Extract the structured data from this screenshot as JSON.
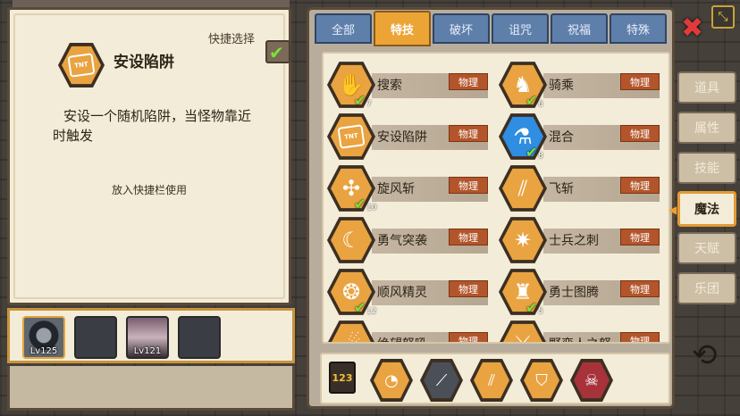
{
  "detail": {
    "quick_select_label": "快捷选择",
    "quick_select_checked": true,
    "icon": "tnt-icon",
    "title": "安设陷阱",
    "description_line1": "安设一个随机陷阱，当怪物靠近",
    "description_line2": "时触发",
    "hint": "放入快捷栏使用"
  },
  "quickbar": {
    "slots": [
      {
        "filled": true,
        "level": "Lv125"
      },
      {
        "filled": false,
        "level": ""
      },
      {
        "filled": true,
        "level": "Lv121"
      },
      {
        "filled": false,
        "level": ""
      }
    ]
  },
  "tabs": [
    "全部",
    "特技",
    "破坏",
    "诅咒",
    "祝福",
    "特殊"
  ],
  "active_tab": "特技",
  "skills": [
    {
      "name": "搜索",
      "type": "物理",
      "icon": "search-hand-icon",
      "checked": true,
      "count": "7"
    },
    {
      "name": "骑乘",
      "type": "物理",
      "icon": "horse-icon",
      "checked": true,
      "count": "6"
    },
    {
      "name": "安设陷阱",
      "type": "物理",
      "icon": "tnt-icon",
      "checked": false,
      "count": ""
    },
    {
      "name": "混合",
      "type": "物理",
      "icon": "flask-icon",
      "checked": true,
      "count": "8"
    },
    {
      "name": "旋风斩",
      "type": "物理",
      "icon": "whirlwind-icon",
      "checked": true,
      "count": "10"
    },
    {
      "name": "飞斩",
      "type": "物理",
      "icon": "flying-slash-icon",
      "checked": false,
      "count": ""
    },
    {
      "name": "勇气突袭",
      "type": "物理",
      "icon": "charge-icon",
      "checked": false,
      "count": ""
    },
    {
      "name": "士兵之刺",
      "type": "物理",
      "icon": "spike-icon",
      "checked": false,
      "count": ""
    },
    {
      "name": "顺风精灵",
      "type": "物理",
      "icon": "wind-spirit-icon",
      "checked": true,
      "count": "12"
    },
    {
      "name": "勇士图腾",
      "type": "物理",
      "icon": "totem-icon",
      "checked": true,
      "count": "5"
    },
    {
      "name": "绝望怒吼",
      "type": "物理",
      "icon": "roar-icon",
      "checked": false,
      "count": ""
    },
    {
      "name": "野蛮人之怒",
      "type": "物理",
      "icon": "barbarian-icon",
      "checked": false,
      "count": ""
    }
  ],
  "loadout_label": "123",
  "quick_skills": [
    "bag-icon",
    "slash-dark-icon",
    "flying-slash-icon",
    "shield-icon",
    "demon-icon"
  ],
  "side_tabs": [
    "道具",
    "属性",
    "技能",
    "魔法",
    "天赋",
    "乐团"
  ],
  "active_side_tab": "魔法"
}
